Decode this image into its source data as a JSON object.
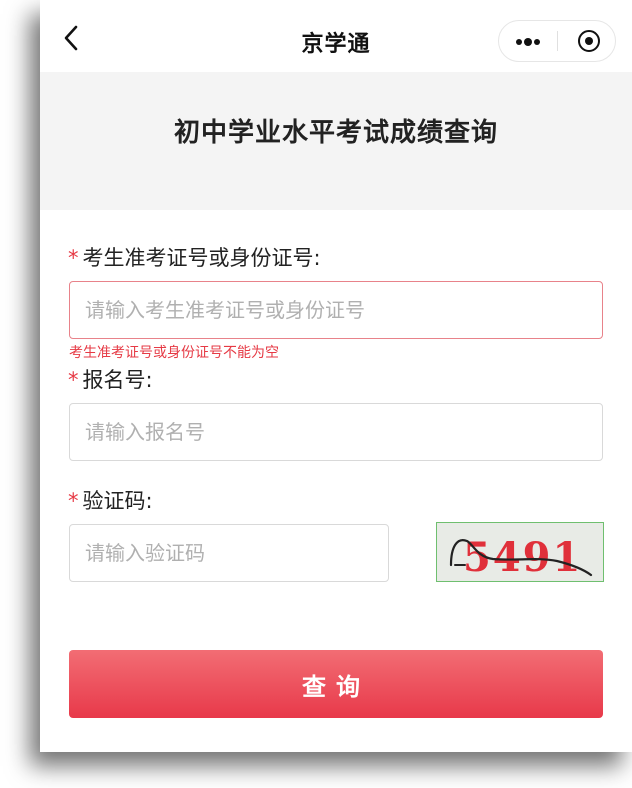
{
  "navbar": {
    "title": "京学通",
    "back_icon": "chevron-left-icon",
    "more_icon": "more-dots-icon",
    "close_icon": "target-circle-icon"
  },
  "header": {
    "title": "初中学业水平考试成绩查询"
  },
  "form": {
    "required_mark": "*",
    "id_field": {
      "label": "考生准考证号或身份证号:",
      "placeholder": "请输入考生准考证号或身份证号",
      "value": "",
      "error": "考生准考证号或身份证号不能为空"
    },
    "reg_field": {
      "label": "报名号:",
      "placeholder": "请输入报名号",
      "value": ""
    },
    "captcha_field": {
      "label": "验证码:",
      "placeholder": "请输入验证码",
      "value": "",
      "captcha_text": "5491"
    },
    "submit_label": "查询"
  },
  "colors": {
    "required": "#e63a45",
    "error_border": "#e8828a",
    "button_top": "#f26d74",
    "button_bottom": "#e8394a",
    "captcha_text": "#e0303a"
  }
}
